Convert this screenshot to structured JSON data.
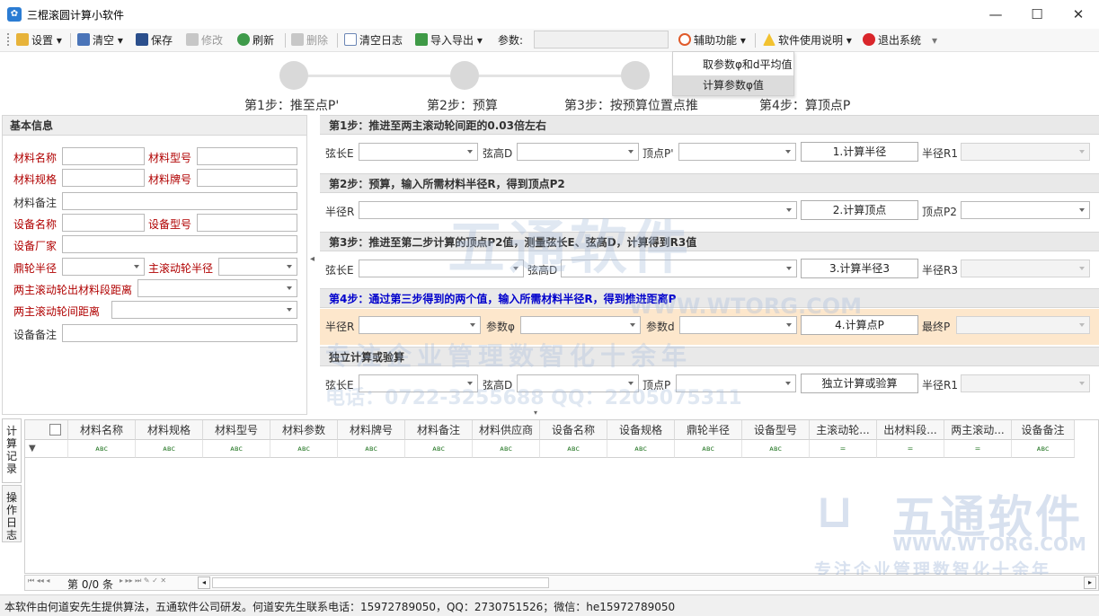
{
  "window": {
    "title": "三棍滚圆计算小软件",
    "minimize": "—",
    "maximize": "☐",
    "close": "✕"
  },
  "toolbar": {
    "settings": "设置",
    "clear": "清空",
    "save": "保存",
    "edit": "修改",
    "refresh": "刷新",
    "delete": "删除",
    "clear_log": "清空日志",
    "import_export": "导入导出",
    "param_label": "参数:",
    "param_value": "",
    "assist": "辅助功能",
    "help": "软件使用说明",
    "exit": "退出系统"
  },
  "assist_menu": {
    "items": [
      "取参数φ和d平均值",
      "计算参数φ值"
    ]
  },
  "steps": [
    {
      "label": "第1步：推至点P'"
    },
    {
      "label": "第2步：预算"
    },
    {
      "label": "第3步：按预算位置点推"
    },
    {
      "label": "第4步：算顶点P"
    }
  ],
  "basic_info": {
    "title": "基本信息",
    "material_name": "材料名称",
    "material_model": "材料型号",
    "material_spec": "材料规格",
    "material_brand": "材料牌号",
    "material_note": "材料备注",
    "device_name": "设备名称",
    "device_model": "设备型号",
    "device_factory": "设备厂家",
    "wheel_radius": "鼎轮半径",
    "main_roller_radius": "主滚动轮半径",
    "exit_distance": "两主滚动轮出材料段距离",
    "roller_distance": "两主滚动轮间距离",
    "device_note": "设备备注"
  },
  "sections": {
    "s1": {
      "title": "第1步：推进至两主滚动轮间距的0.03倍左右",
      "chord_e": "弦长E",
      "chord_d": "弦高D",
      "vertex": "顶点P'",
      "button": "1.计算半径",
      "radius": "半径R1"
    },
    "s2": {
      "title": "第2步：预算，输入所需材料半径R，得到顶点P2",
      "radius": "半径R",
      "button": "2.计算顶点",
      "vertex": "顶点P2"
    },
    "s3": {
      "title": "第3步：推进至第二步计算的顶点P2值，测量弦长E、弦高D，计算得到R3值",
      "chord_e": "弦长E",
      "chord_d": "弦高D",
      "button": "3.计算半径3",
      "radius": "半径R3"
    },
    "s4": {
      "title": "第4步：通过第三步得到的两个值，输入所需材料半径R，得到推进距离P",
      "radius": "半径R",
      "param_phi": "参数φ",
      "param_d": "参数d",
      "button": "4.计算点P",
      "final": "最终P"
    },
    "s5": {
      "title": "独立计算或验算",
      "chord_e": "弦长E",
      "chord_d": "弦高D",
      "vertex": "顶点P",
      "button": "独立计算或验算",
      "radius": "半径R1"
    }
  },
  "watermark": {
    "brand": "五通软件",
    "url": "WWW.WTORG.COM",
    "slogan": "专注企业管理数智化十余年",
    "contact": "电话：0722-3255688  QQ：2205075311"
  },
  "side_tabs": [
    "计算记录",
    "操作日志"
  ],
  "grid": {
    "columns": [
      "材料名称",
      "材料规格",
      "材料型号",
      "材料参数",
      "材料牌号",
      "材料备注",
      "材料供应商",
      "设备名称",
      "设备规格",
      "鼎轮半径",
      "设备型号",
      "主滚动轮...",
      "出材料段...",
      "两主滚动...",
      "设备备注"
    ],
    "filters": [
      "ᴀʙc",
      "ᴀʙc",
      "ᴀʙc",
      "ᴀʙc",
      "ᴀʙc",
      "ᴀʙc",
      "ᴀʙc",
      "ᴀʙc",
      "ᴀʙc",
      "ᴀʙc",
      "ᴀʙc",
      "=",
      "=",
      "=",
      "ᴀʙc"
    ],
    "pager": "第 0/0 条"
  },
  "status": {
    "text": "本软件由何道安先生提供算法，五通软件公司研发。何道安先生联系电话：15972789050，QQ：2730751526；微信：he15972789050"
  },
  "colors": {
    "accent": "#2b7cd3",
    "required_label": "#b00000",
    "section_blue": "#0000cc",
    "step4_bg": "#fde7cc"
  }
}
